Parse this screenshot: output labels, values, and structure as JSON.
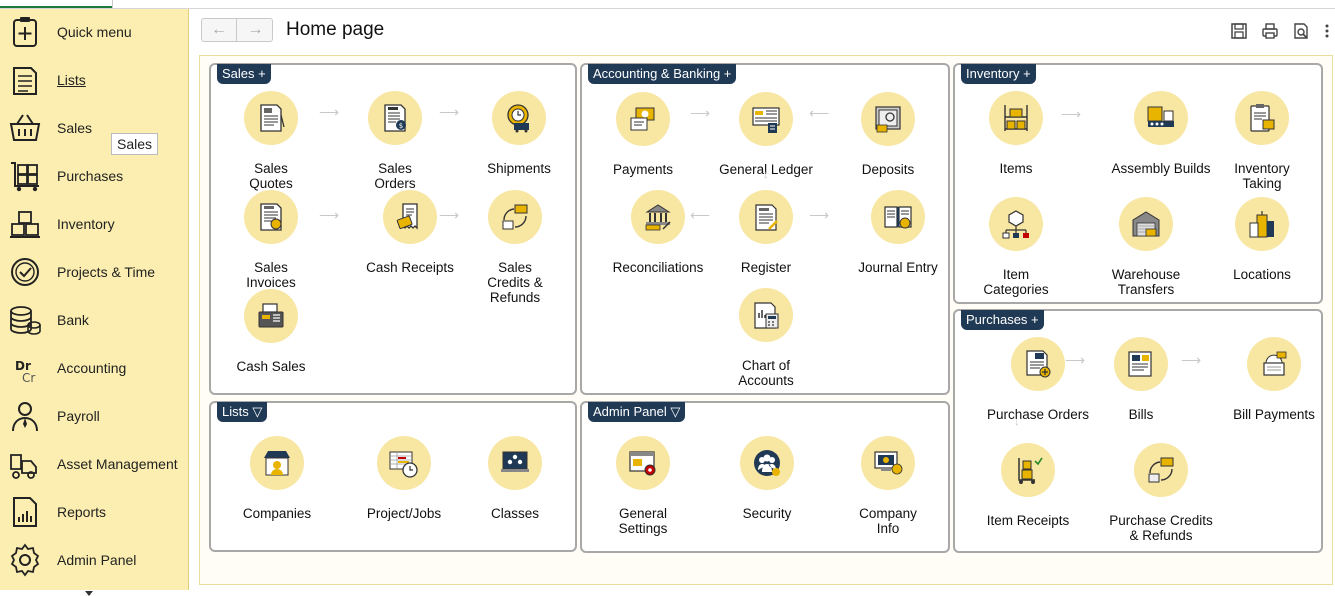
{
  "sidebar": {
    "items": [
      {
        "label": "Quick menu",
        "icon": "quick-menu-icon"
      },
      {
        "label": "Lists",
        "icon": "lists-icon"
      },
      {
        "label": "Sales",
        "icon": "basket-icon"
      },
      {
        "label": "Purchases",
        "icon": "purchases-icon"
      },
      {
        "label": "Inventory",
        "icon": "inventory-icon"
      },
      {
        "label": "Projects & Time",
        "icon": "projects-icon"
      },
      {
        "label": "Bank",
        "icon": "bank-icon"
      },
      {
        "label": "Accounting",
        "icon": "accounting-icon"
      },
      {
        "label": "Payroll",
        "icon": "payroll-icon"
      },
      {
        "label": "Asset Management",
        "icon": "asset-icon"
      },
      {
        "label": "Reports",
        "icon": "reports-icon"
      },
      {
        "label": "Admin Panel",
        "icon": "gear-icon"
      }
    ],
    "tooltip": "Sales"
  },
  "header": {
    "title": "Home page",
    "back_glyph": "←",
    "forward_glyph": "→"
  },
  "panels": {
    "sales": {
      "title": "Sales +",
      "items": [
        {
          "label": "Sales\nQuotes"
        },
        {
          "label": "Sales\nOrders"
        },
        {
          "label": "Shipments"
        },
        {
          "label": "Sales\nInvoices"
        },
        {
          "label": "Cash Receipts"
        },
        {
          "label": "Sales\nCredits &\nRefunds"
        },
        {
          "label": "Cash Sales"
        }
      ]
    },
    "accounting": {
      "title": "Accounting & Banking +",
      "items": [
        {
          "label": "Payments"
        },
        {
          "label": "General Ledger"
        },
        {
          "label": "Deposits"
        },
        {
          "label": "Reconciliations"
        },
        {
          "label": "Register"
        },
        {
          "label": "Journal Entry"
        },
        {
          "label": "Chart of\nAccounts"
        }
      ]
    },
    "inventory": {
      "title": "Inventory +",
      "items": [
        {
          "label": "Items"
        },
        {
          "label": "Assembly Builds"
        },
        {
          "label": "Inventory\nTaking"
        },
        {
          "label": "Item\nCategories"
        },
        {
          "label": "Warehouse\nTransfers"
        },
        {
          "label": "Locations"
        }
      ]
    },
    "lists": {
      "title": "Lists ▽",
      "items": [
        {
          "label": "Companies"
        },
        {
          "label": "Project/Jobs"
        },
        {
          "label": "Classes"
        }
      ]
    },
    "admin": {
      "title": "Admin Panel ▽",
      "items": [
        {
          "label": "General\nSettings"
        },
        {
          "label": "Security"
        },
        {
          "label": "Company\nInfo"
        }
      ]
    },
    "purchases": {
      "title": "Purchases +",
      "items": [
        {
          "label": "Purchase Orders"
        },
        {
          "label": "Bills"
        },
        {
          "label": "Bill Payments"
        },
        {
          "label": "Item Receipts"
        },
        {
          "label": "Purchase Credits\n& Refunds"
        }
      ]
    }
  },
  "colors": {
    "sidebar_bg": "#fbeeb0",
    "panel_title_bg": "#203a55",
    "icon_circle": "#f8e6a3",
    "accent_gold": "#e8b400"
  }
}
